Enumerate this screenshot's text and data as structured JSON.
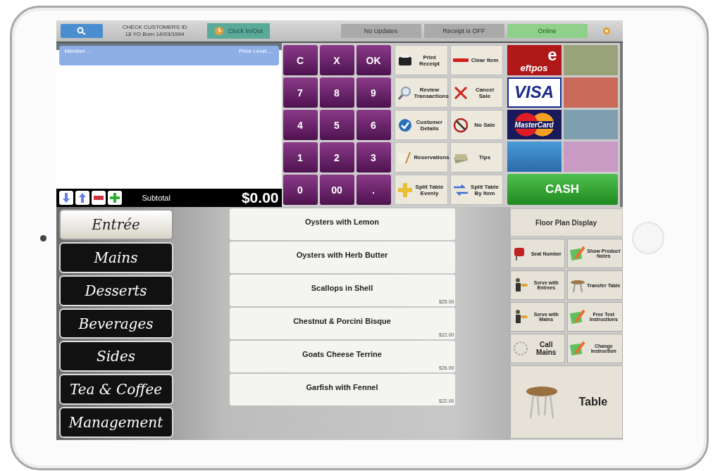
{
  "top_bar": {
    "customer_check": [
      "CHECK CUSTOMERS ID",
      "18 YO Born 14/03/1994"
    ],
    "clock_button": "Clock In/Out",
    "status": [
      {
        "label": "No Updates",
        "kind": "info"
      },
      {
        "label": "Receipt is OFF",
        "kind": "info"
      },
      {
        "label": "Online",
        "kind": "online"
      }
    ]
  },
  "order": {
    "member": "Member ...",
    "price_level": "Price Level ...",
    "subtotal_label": "Subtotal",
    "subtotal": "$0.00"
  },
  "keypad": [
    "C",
    "X",
    "OK",
    "7",
    "8",
    "9",
    "4",
    "5",
    "6",
    "1",
    "2",
    "3",
    "0",
    "00",
    "."
  ],
  "functions": [
    {
      "label": "Print Receipt"
    },
    {
      "label": "Clear Item"
    },
    {
      "label": "Review Transactions"
    },
    {
      "label": "Cancel Sale"
    },
    {
      "label": "Customer Details"
    },
    {
      "label": "No Sale"
    },
    {
      "label": "Reservations"
    },
    {
      "label": "Tips"
    },
    {
      "label": "Split Table Evenly"
    },
    {
      "label": "Split Table By Item"
    }
  ],
  "payments": {
    "cards": [
      {
        "kind": "eftpos",
        "logo_letter": "e",
        "label": "eftpos"
      },
      {
        "kind": "visa",
        "label": "VISA"
      },
      {
        "kind": "mastercard",
        "label": "MasterCard"
      },
      {
        "kind": "amex"
      }
    ],
    "cash": "CASH"
  },
  "categories": [
    {
      "label": "Entrée",
      "selected": true
    },
    {
      "label": "Mains",
      "selected": false
    },
    {
      "label": "Desserts",
      "selected": false
    },
    {
      "label": "Beverages",
      "selected": false
    },
    {
      "label": "Sides",
      "selected": false
    },
    {
      "label": "Tea & Coffee",
      "selected": false
    },
    {
      "label": "Management",
      "selected": false
    }
  ],
  "menu_items": [
    {
      "name": "Oysters with Lemon"
    },
    {
      "name": "Oysters with Herb Butter"
    },
    {
      "name": "Scallops in Shell",
      "price": "$25.00"
    },
    {
      "name": "Chestnut & Porcini Bisque",
      "price": "$22.00"
    },
    {
      "name": "Goats Cheese Terrine",
      "price": "$26.00"
    },
    {
      "name": "Garfish with Fennel",
      "price": "$22.00"
    }
  ],
  "right_panel": {
    "floor_plan": "Floor Plan Display",
    "actions": [
      "Seat Number",
      "Show Product Notes",
      "Serve with Entrees",
      "Transfer Table",
      "Serve with Mains",
      "Free Text Instructions",
      "Call Mains",
      "Change Instruction"
    ],
    "table": "Table"
  }
}
